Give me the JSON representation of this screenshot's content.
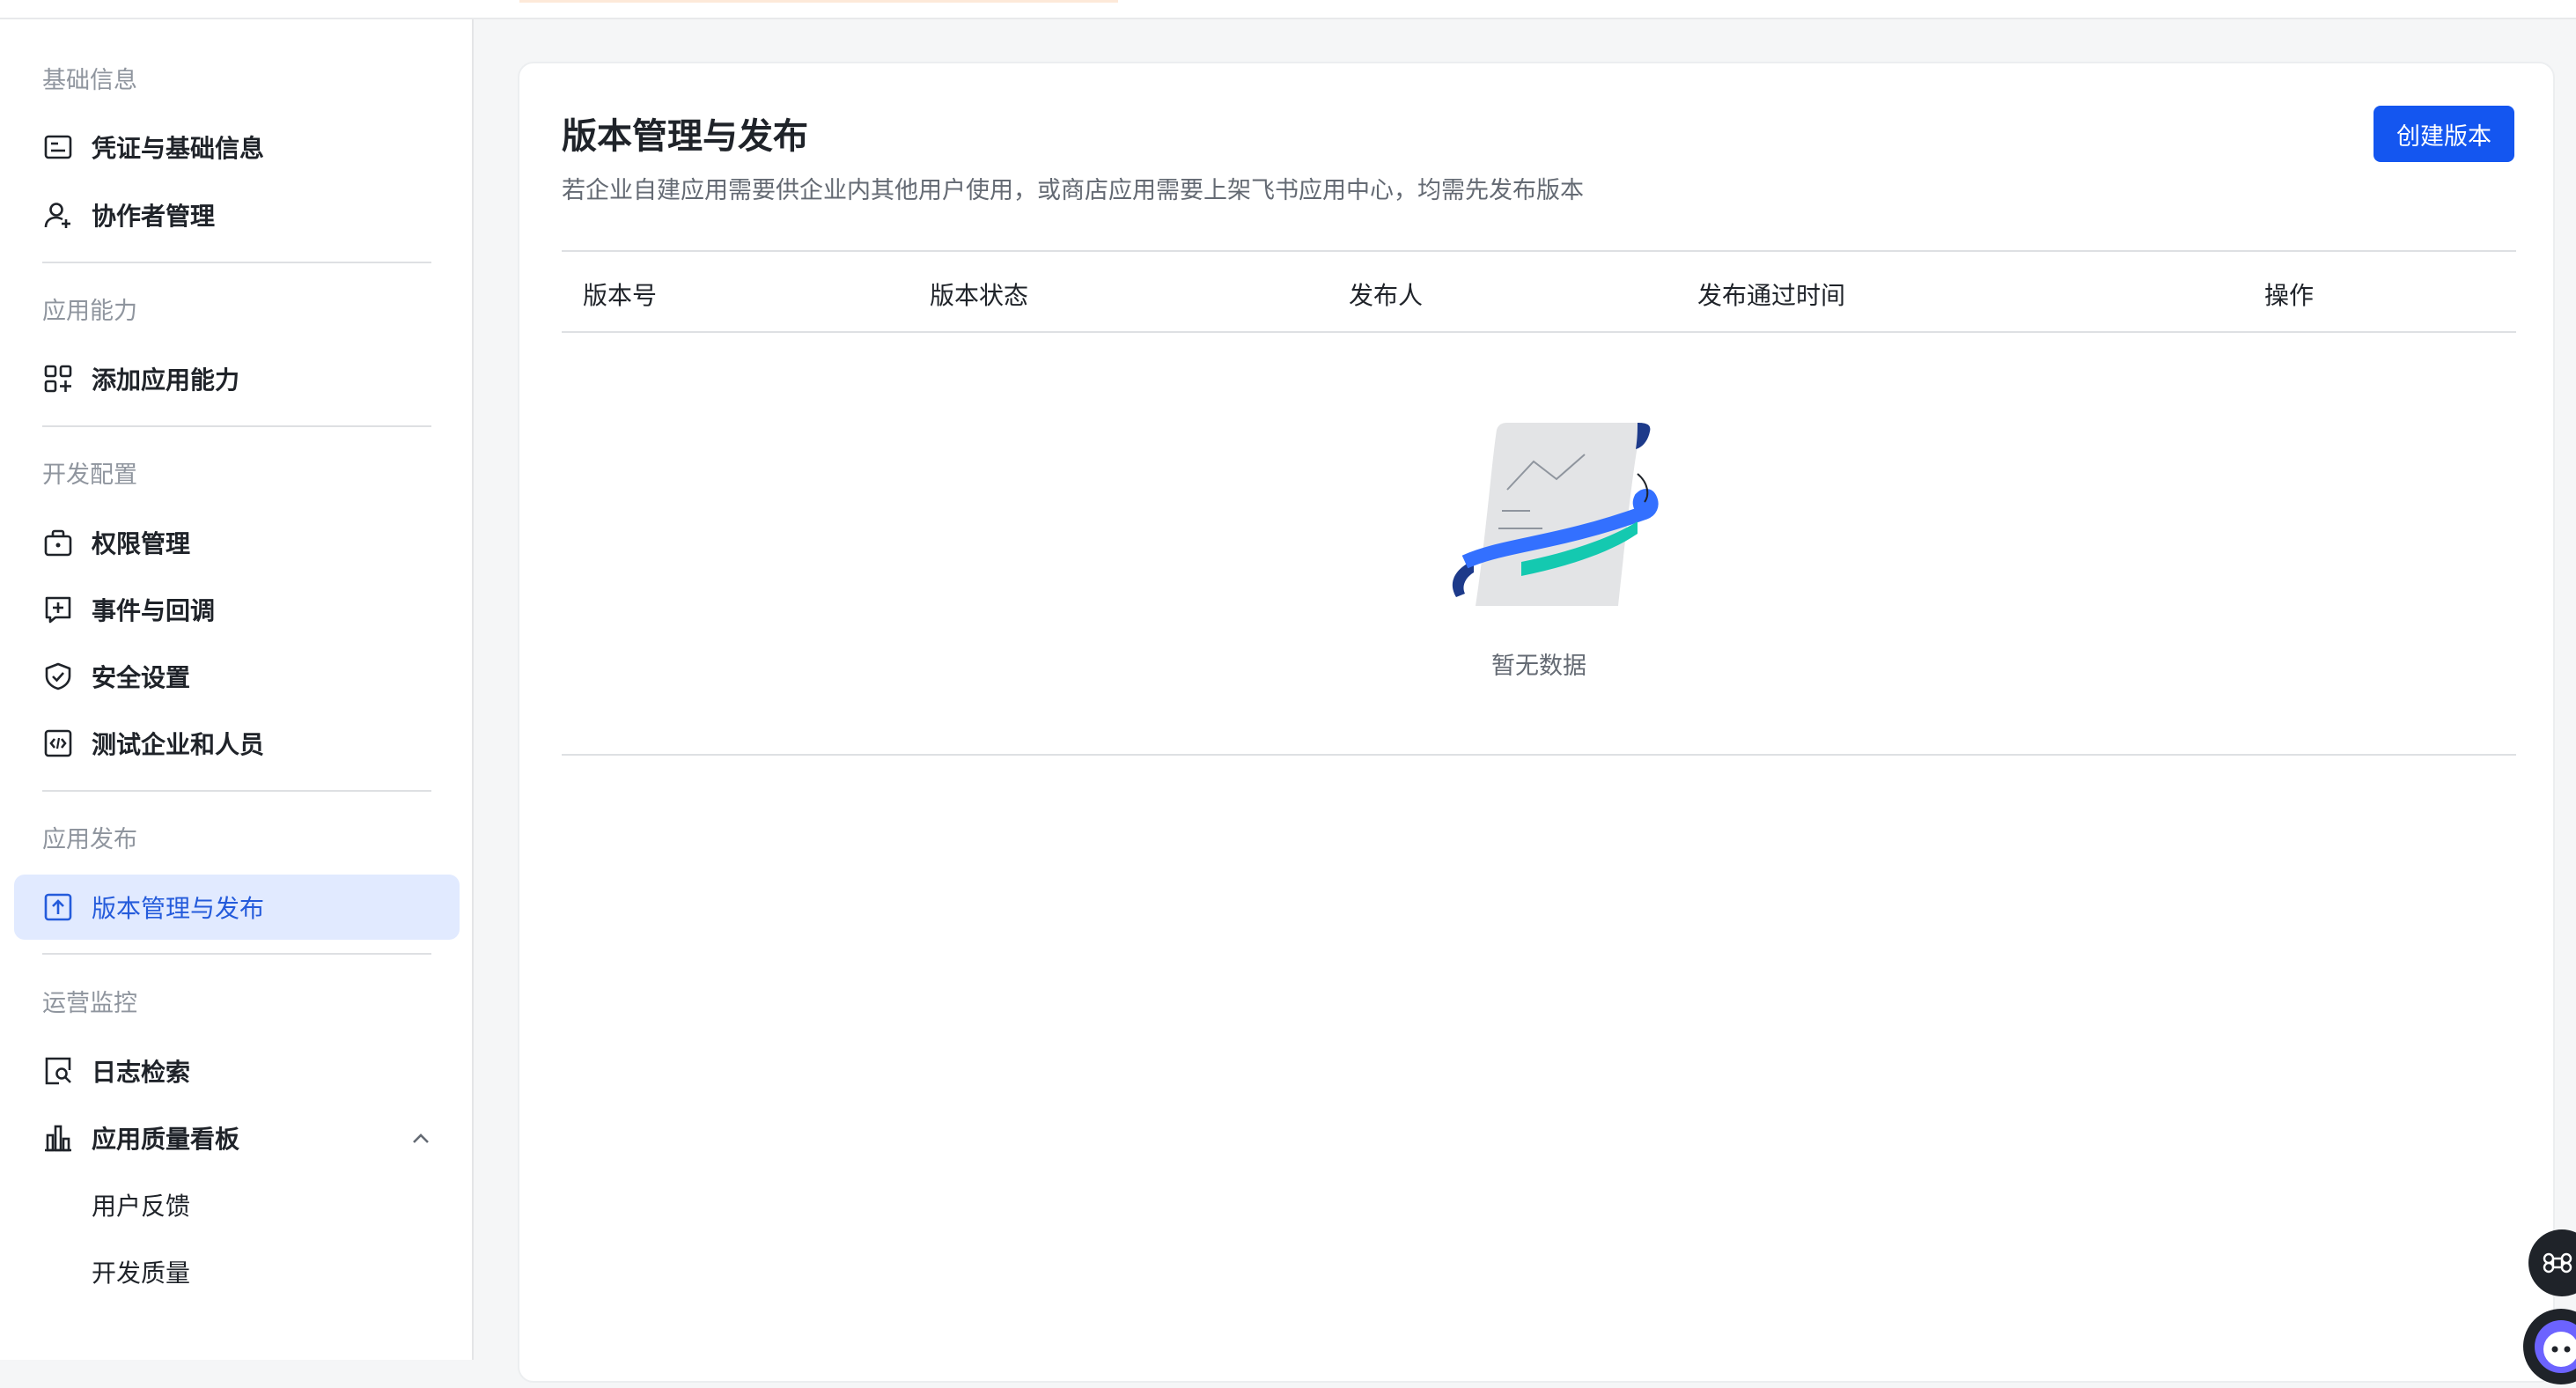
{
  "sidebar": {
    "groups": [
      {
        "title": "基础信息",
        "items": [
          {
            "label": "凭证与基础信息",
            "icon": "credential-card-icon"
          },
          {
            "label": "协作者管理",
            "icon": "user-add-icon"
          }
        ]
      },
      {
        "title": "应用能力",
        "items": [
          {
            "label": "添加应用能力",
            "icon": "app-add-icon"
          }
        ]
      },
      {
        "title": "开发配置",
        "items": [
          {
            "label": "权限管理",
            "icon": "permission-icon"
          },
          {
            "label": "事件与回调",
            "icon": "event-callback-icon"
          },
          {
            "label": "安全设置",
            "icon": "shield-icon"
          },
          {
            "label": "测试企业和人员",
            "icon": "code-test-icon"
          }
        ]
      },
      {
        "title": "应用发布",
        "items": [
          {
            "label": "版本管理与发布",
            "icon": "upload-version-icon",
            "active": true
          }
        ]
      },
      {
        "title": "运营监控",
        "items": [
          {
            "label": "日志检索",
            "icon": "log-search-icon"
          },
          {
            "label": "应用质量看板",
            "icon": "bar-chart-icon",
            "expanded": true
          },
          {
            "label": "用户反馈"
          },
          {
            "label": "开发质量"
          }
        ]
      }
    ]
  },
  "main": {
    "title": "版本管理与发布",
    "description": "若企业自建应用需要供企业内其他用户使用，或商店应用需要上架飞书应用中心，均需先发布版本",
    "create_button": "创建版本",
    "table": {
      "columns": [
        "版本号",
        "版本状态",
        "发布人",
        "发布通过时间",
        "操作"
      ],
      "rows": [],
      "empty_text": "暂无数据"
    }
  },
  "colors": {
    "primary": "#1456f0",
    "active_bg": "#e1eaff",
    "active_text": "#245bdb",
    "border": "#dee0e3"
  }
}
